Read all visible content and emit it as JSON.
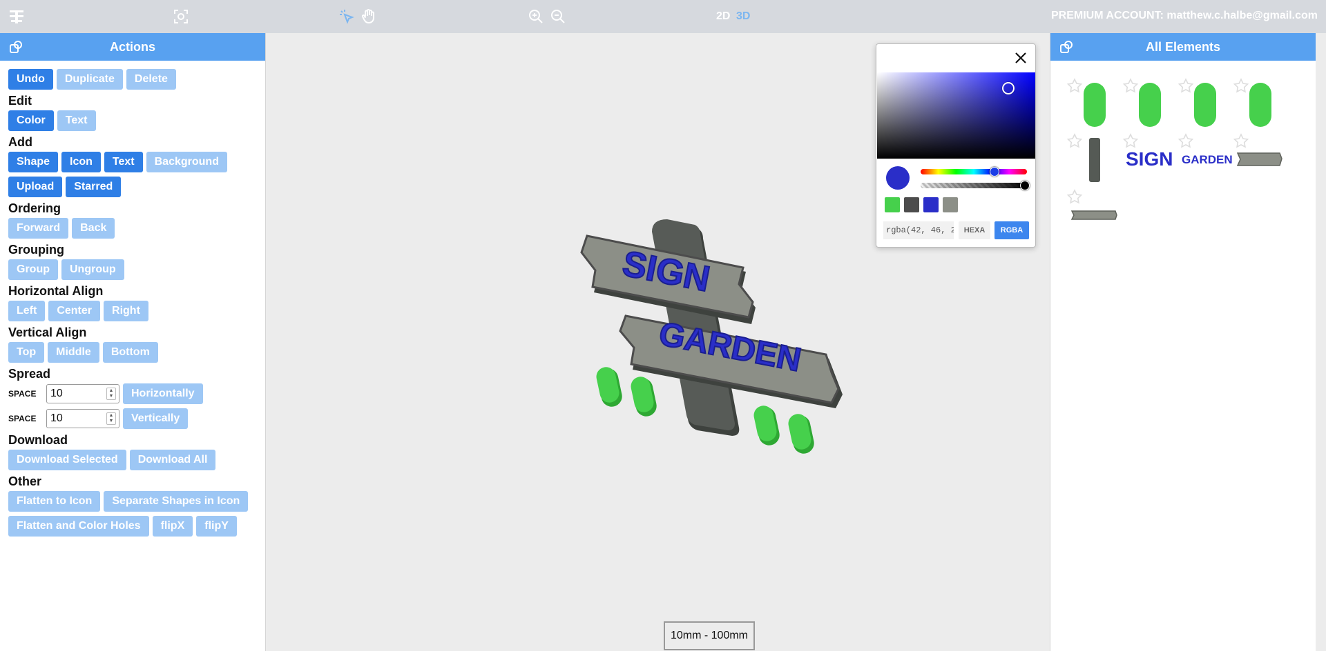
{
  "topbar": {
    "mode_2d": "2D",
    "mode_3d": "3D",
    "account": "PREMIUM ACCOUNT: matthew.c.halbe@gmail.com",
    "icons": [
      "logo-icon",
      "fit-view-icon",
      "select-cursor-icon",
      "pan-hand-icon",
      "zoom-in-icon",
      "zoom-out-icon"
    ]
  },
  "actions_panel": {
    "title": "Actions",
    "top_buttons": [
      "Undo",
      "Duplicate",
      "Delete"
    ],
    "edit": {
      "label": "Edit",
      "buttons": [
        "Color",
        "Text"
      ]
    },
    "add": {
      "label": "Add",
      "row1": [
        "Shape",
        "Icon",
        "Text",
        "Background"
      ],
      "row2": [
        "Upload",
        "Starred"
      ]
    },
    "ordering": {
      "label": "Ordering",
      "buttons": [
        "Forward",
        "Back"
      ]
    },
    "grouping": {
      "label": "Grouping",
      "buttons": [
        "Group",
        "Ungroup"
      ]
    },
    "halign": {
      "label": "Horizontal Align",
      "buttons": [
        "Left",
        "Center",
        "Right"
      ]
    },
    "valign": {
      "label": "Vertical Align",
      "buttons": [
        "Top",
        "Middle",
        "Bottom"
      ]
    },
    "spread": {
      "label": "Spread",
      "space_label": "SPACE",
      "h_value": "10",
      "v_value": "10",
      "h_button": "Horizontally",
      "v_button": "Vertically"
    },
    "download": {
      "label": "Download",
      "buttons": [
        "Download Selected",
        "Download All"
      ]
    },
    "other": {
      "label": "Other",
      "row1": [
        "Flatten to Icon",
        "Separate Shapes in Icon"
      ],
      "row2": [
        "Flatten and Color Holes",
        "flipX",
        "flipY"
      ]
    }
  },
  "elements_panel": {
    "title": "All Elements",
    "items": [
      "green-pill",
      "green-pill",
      "green-pill",
      "green-pill",
      "dark-post",
      "SIGN",
      "GARDEN",
      "gray-plank",
      "gray-plank"
    ]
  },
  "canvas": {
    "size_range": "10mm - 100mm",
    "sign_text_1": "SIGN",
    "sign_text_2": "GARDEN"
  },
  "color_picker": {
    "value": "rgba(42, 46, 2",
    "format_hexa": "HEXA",
    "format_rgba": "RGBA",
    "current_color": "#2a2ec8",
    "presets": [
      "#46d04c",
      "#4c4c4c",
      "#2a2ec8",
      "#8c8f87"
    ]
  },
  "colors": {
    "accent": "#2f7fe6",
    "accent_disabled": "#9dc7f5",
    "header": "#58a1f0",
    "pill_green": "#46d04c",
    "post_gray": "#555a55",
    "plank_gray": "#8c8f87",
    "text_blue": "#2a2ec8"
  }
}
